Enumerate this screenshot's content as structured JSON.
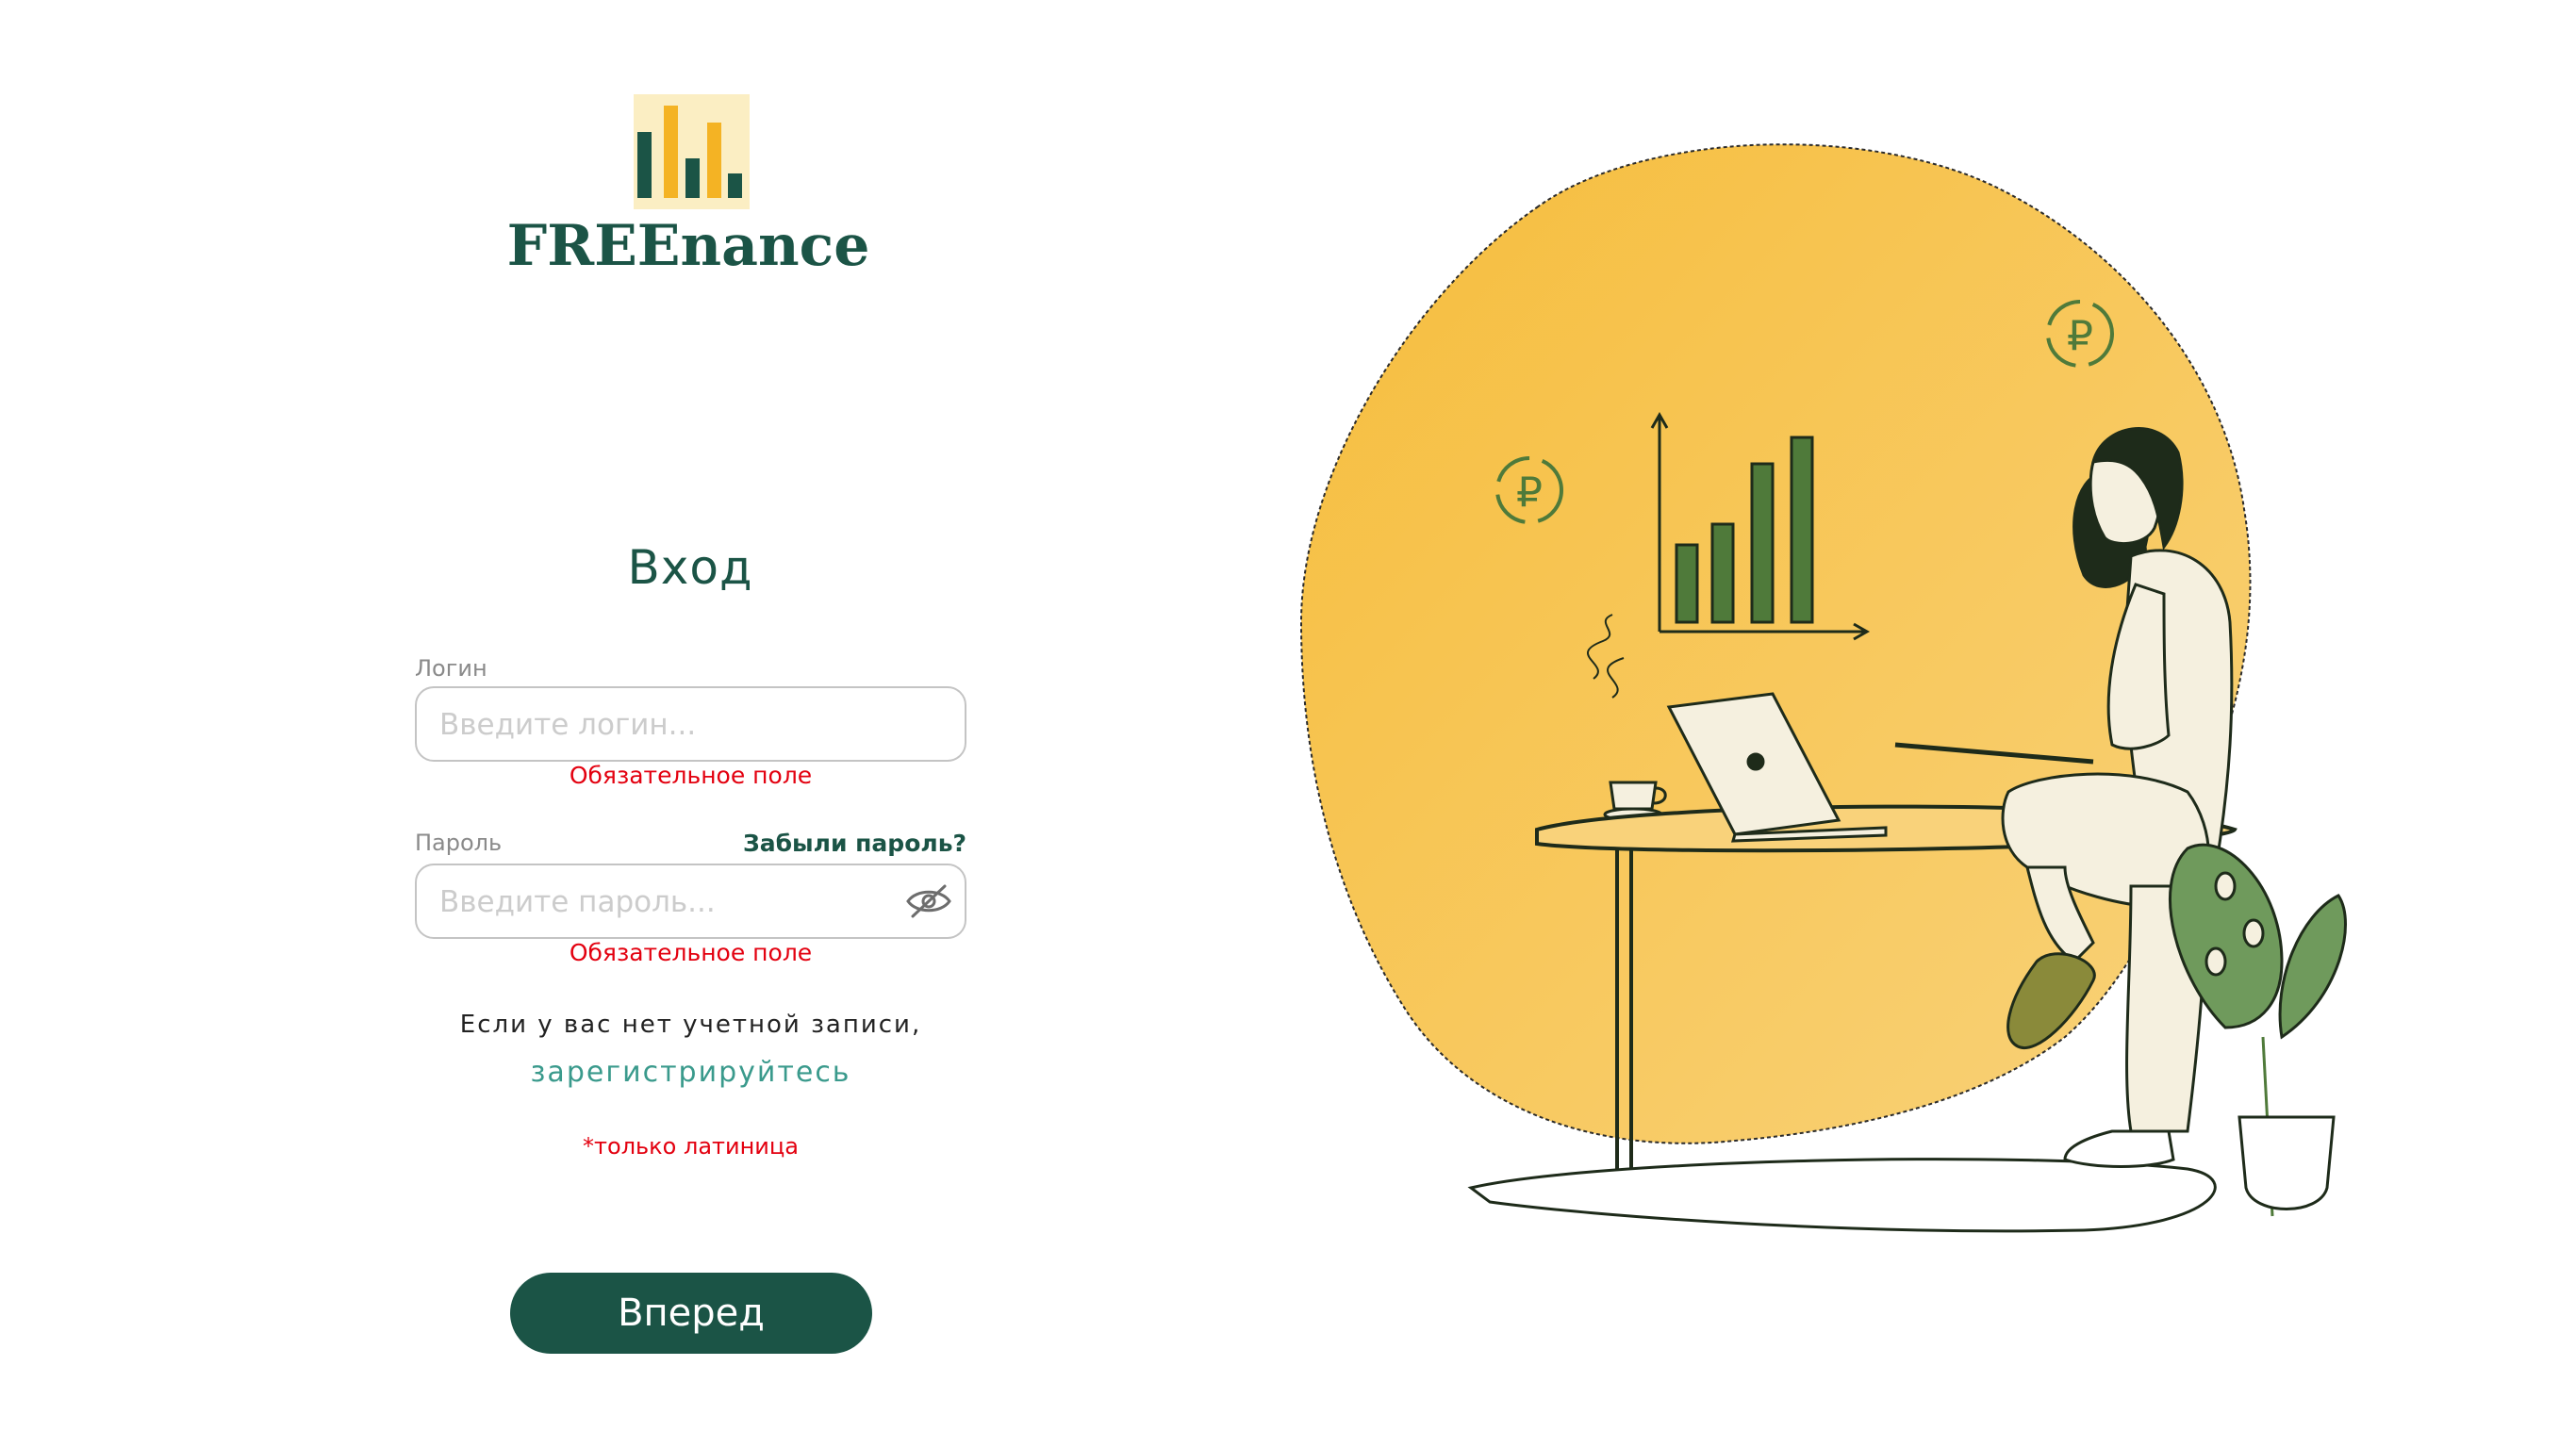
{
  "brand": {
    "name": "FREEnance",
    "colors": {
      "primary": "#1b5446",
      "accent": "#f4b324",
      "logo_bg": "#fbeec3"
    }
  },
  "login": {
    "title": "Вход",
    "username": {
      "label": "Логин",
      "placeholder": "Введите логин...",
      "value": "",
      "error": "Обязательное поле"
    },
    "password": {
      "label": "Пароль",
      "placeholder": "Введите пароль...",
      "value": "",
      "error": "Обязательное поле",
      "toggle_icon": "eye-slash-icon"
    },
    "forgot_password": "Забыли пароль?",
    "no_account_text": "Если у вас нет учетной записи,",
    "register_link": "зарегистрируйтесь",
    "latin_note": "*только латиница",
    "submit_label": "Вперед"
  },
  "illustration": {
    "currency_symbol": "₽",
    "colors": {
      "blob": "#f6c24a",
      "ink": "#1e2b1a",
      "bars": "#4f7a3a",
      "plant": "#6f9a5c",
      "cream": "#f5f0df"
    }
  }
}
